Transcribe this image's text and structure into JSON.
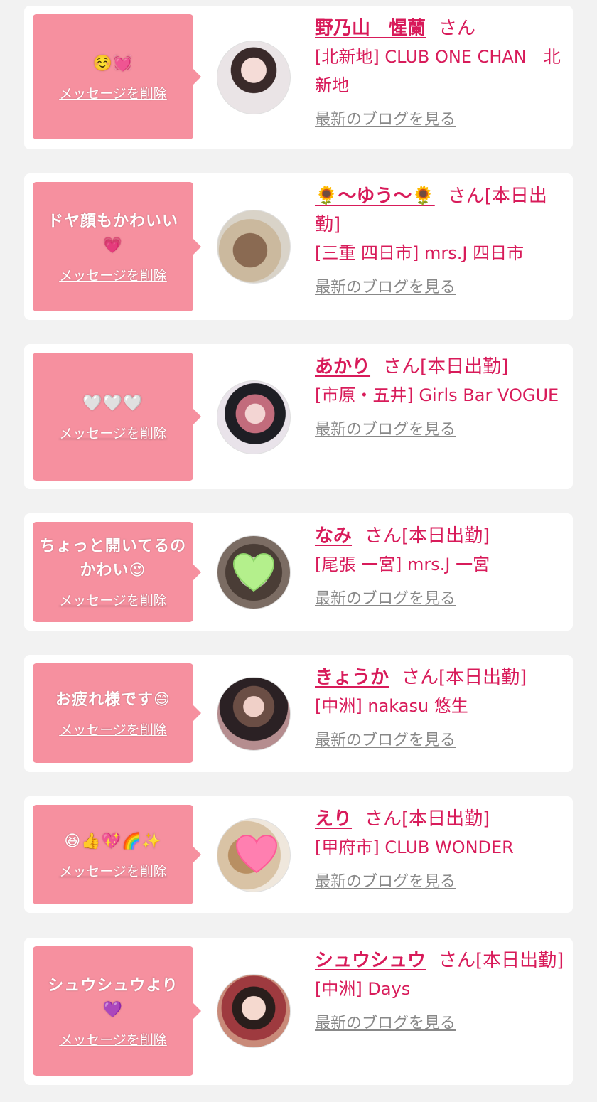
{
  "items": [
    {
      "message": "☺️💓",
      "delete_label": "メッセージを削除",
      "name": "野乃山　惺蘭",
      "honorific": "さん",
      "status": "",
      "shop": "[北新地] CLUB ONE CHAN　北新地",
      "blog_label": "最新のブログを見る",
      "avatar": "photo-avatar"
    },
    {
      "message": "ドヤ顔もかわいい💗",
      "delete_label": "メッセージを削除",
      "name": "🌻〜ゆう〜🌻",
      "honorific": "さん",
      "status": "[本日出勤]",
      "shop": "[三重 四日市] mrs.J 四日市",
      "blog_label": "最新のブログを見る",
      "avatar": "photo-avatar"
    },
    {
      "message": "🤍🤍🤍",
      "delete_label": "メッセージを削除",
      "name": "あかり",
      "honorific": "さん",
      "status": "[本日出勤]",
      "shop": "[市原・五井] Girls Bar VOGUE",
      "blog_label": "最新のブログを見る",
      "avatar": "photo-avatar"
    },
    {
      "message": "ちょっと開いてるのかわい😍",
      "delete_label": "メッセージを削除",
      "name": "なみ",
      "honorific": "さん",
      "status": "[本日出勤]",
      "shop": "[尾張 一宮] mrs.J 一宮",
      "blog_label": "最新のブログを見る",
      "avatar": "green-heart-sticker"
    },
    {
      "message": "お疲れ様です😄",
      "delete_label": "メッセージを削除",
      "name": "きょうか",
      "honorific": "さん",
      "status": "[本日出勤]",
      "shop": "[中洲] nakasu 悠生",
      "blog_label": "最新のブログを見る",
      "avatar": "photo-avatar"
    },
    {
      "message": "😆👍💖🌈✨",
      "delete_label": "メッセージを削除",
      "name": "えり",
      "honorific": "さん",
      "status": "[本日出勤]",
      "shop": "[甲府市] CLUB WONDER",
      "blog_label": "最新のブログを見る",
      "avatar": "pink-heart-sticker"
    },
    {
      "message": "シュウシュウより💜",
      "delete_label": "メッセージを削除",
      "name": "シュウシュウ",
      "honorific": "さん",
      "status": "[本日出勤]",
      "shop": "[中洲] Days",
      "blog_label": "最新のブログを見る",
      "avatar": "photo-avatar"
    }
  ],
  "colors": {
    "bubble": "#f6909f",
    "accent": "#d81b5a",
    "link_gray": "#888888",
    "background": "#f2f2f2",
    "card": "#ffffff"
  }
}
